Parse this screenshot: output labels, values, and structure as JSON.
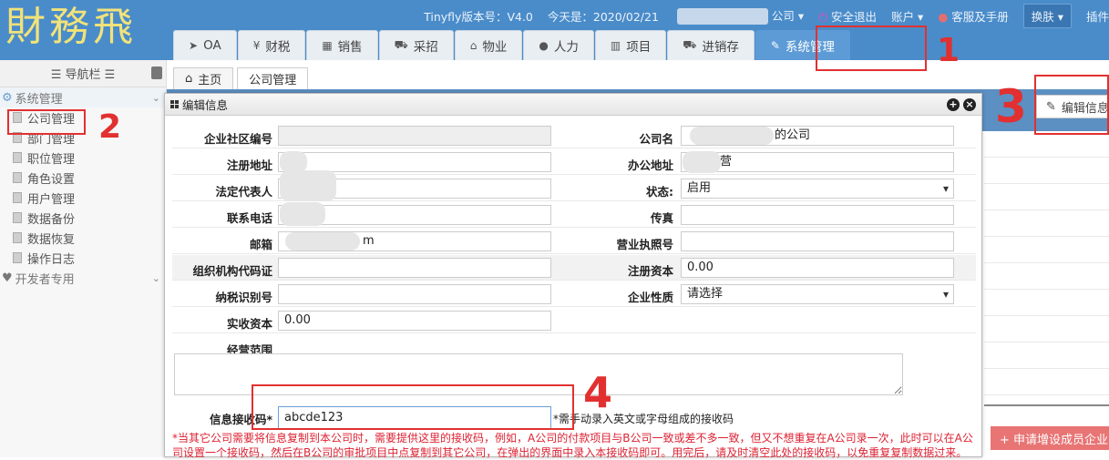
{
  "header": {
    "logo": "財務飛",
    "version": "Tinyfly版本号：V4.0",
    "today": "今天是：2020/02/21",
    "company_suffix": "公司 ▾",
    "logout": "安全退出",
    "account": "账户 ▾",
    "service": "客服及手册",
    "skin": "换肤 ▾",
    "plugin": "插件"
  },
  "main_tabs": [
    {
      "icon": "paper-plane-icon",
      "glyph": "➤",
      "label": "OA"
    },
    {
      "icon": "yen-icon",
      "glyph": "¥",
      "label": "财税"
    },
    {
      "icon": "table-icon",
      "glyph": "▦",
      "label": "销售"
    },
    {
      "icon": "cart-icon",
      "glyph": "⛟",
      "label": "采招"
    },
    {
      "icon": "bank-icon",
      "glyph": "⌂",
      "label": "物业"
    },
    {
      "icon": "user-icon",
      "glyph": "●",
      "label": "人力"
    },
    {
      "icon": "building-icon",
      "glyph": "▥",
      "label": "项目"
    },
    {
      "icon": "truck-icon",
      "glyph": "⛟",
      "label": "进销存"
    },
    {
      "icon": "wrench-icon",
      "glyph": "✎",
      "label": "系统管理"
    }
  ],
  "sidebar": {
    "title": "☰ 导航栏 ☰",
    "group1": "系统管理",
    "items": [
      "公司管理",
      "部门管理",
      "职位管理",
      "角色设置",
      "用户管理",
      "数据备份",
      "数据恢复",
      "操作日志"
    ],
    "group2": "开发者专用"
  },
  "content_tabs": {
    "home": "主页",
    "company": "公司管理"
  },
  "right": {
    "edit": "编辑信息",
    "apply": "+ 申请增设成员企业"
  },
  "dialog": {
    "title": "编辑信息",
    "fields": {
      "community_no": {
        "label": "企业社区编号",
        "value": ""
      },
      "company_name": {
        "label": "公司名",
        "value": "的公司"
      },
      "reg_addr": {
        "label": "注册地址",
        "value": ""
      },
      "office_addr": {
        "label": "办公地址",
        "value": "营"
      },
      "legal_rep": {
        "label": "法定代表人",
        "value": ""
      },
      "status": {
        "label": "状态:",
        "value": "启用"
      },
      "phone": {
        "label": "联系电话",
        "value": ""
      },
      "fax": {
        "label": "传真",
        "value": ""
      },
      "email": {
        "label": "邮箱",
        "value": "m"
      },
      "license": {
        "label": "营业执照号",
        "value": ""
      },
      "org_code": {
        "label": "组织机构代码证",
        "value": ""
      },
      "reg_capital": {
        "label": "注册资本",
        "value": "0.00"
      },
      "tax_id": {
        "label": "纳税识别号",
        "value": ""
      },
      "nature": {
        "label": "企业性质",
        "value": "请选择"
      },
      "paid_capital": {
        "label": "实收资本",
        "value": "0.00"
      },
      "scope": {
        "label": "经营范围",
        "value": ""
      },
      "recv_code": {
        "label": "信息接收码*",
        "value": "abcde123",
        "hint": "*需手动录入英文或字母组成的接收码"
      }
    },
    "note": "*当其它公司需要将信息复制到本公司时，需要提供这里的接收码，例如，A公司的付款项目与B公司一致或差不多一致，但又不想重复在A公司录一次，此时可以在A公司设置一个接收码，然后在B公司的审批项目中点复制到其它公司，在弹出的界面中录入本接收码即可。用完后，请及时清空此处的接收码，以免重复复制数据过来。"
  },
  "annotations": [
    "1",
    "2",
    "3",
    "4"
  ]
}
